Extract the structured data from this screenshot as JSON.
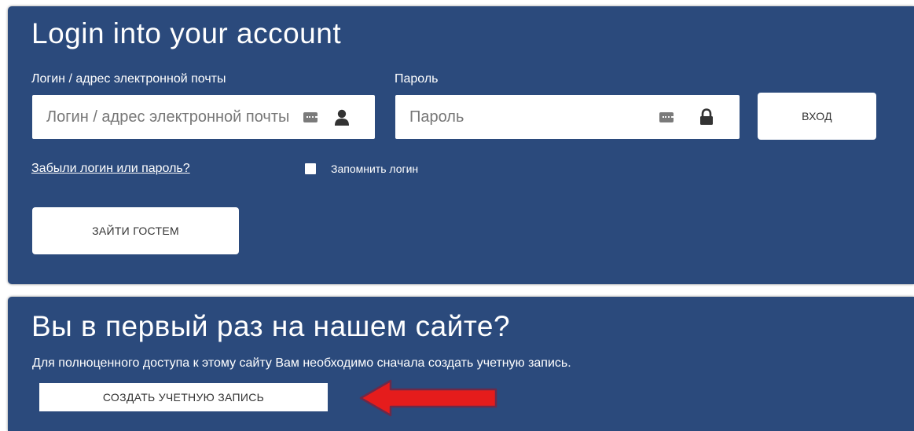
{
  "login": {
    "title": "Login into your account",
    "username_label": "Логин / адрес электронной почты",
    "username_placeholder": "Логин / адрес электронной почты",
    "password_label": "Пароль",
    "password_placeholder": "Пароль",
    "login_button": "ВХОД",
    "forgot_link": "Забыли логин или пароль?",
    "remember_label": "Запомнить логин",
    "guest_button": "ЗАЙТИ ГОСТЕМ"
  },
  "signup": {
    "title": "Вы в первый раз на нашем сайте?",
    "description": "Для полноценного доступа к этому сайту Вам необходимо сначала создать учетную запись.",
    "create_button": "СОЗДАТЬ УЧЕТНУЮ ЗАПИСЬ"
  },
  "colors": {
    "panel_bg": "#2b4a7c",
    "arrow_fill": "#e51c1c",
    "arrow_outline": "#6b2a4a"
  },
  "icons": {
    "username_field": [
      "keyboard-icon",
      "user-icon"
    ],
    "password_field": [
      "keyboard-icon",
      "lock-icon"
    ],
    "annotation": "arrow-left-icon"
  }
}
